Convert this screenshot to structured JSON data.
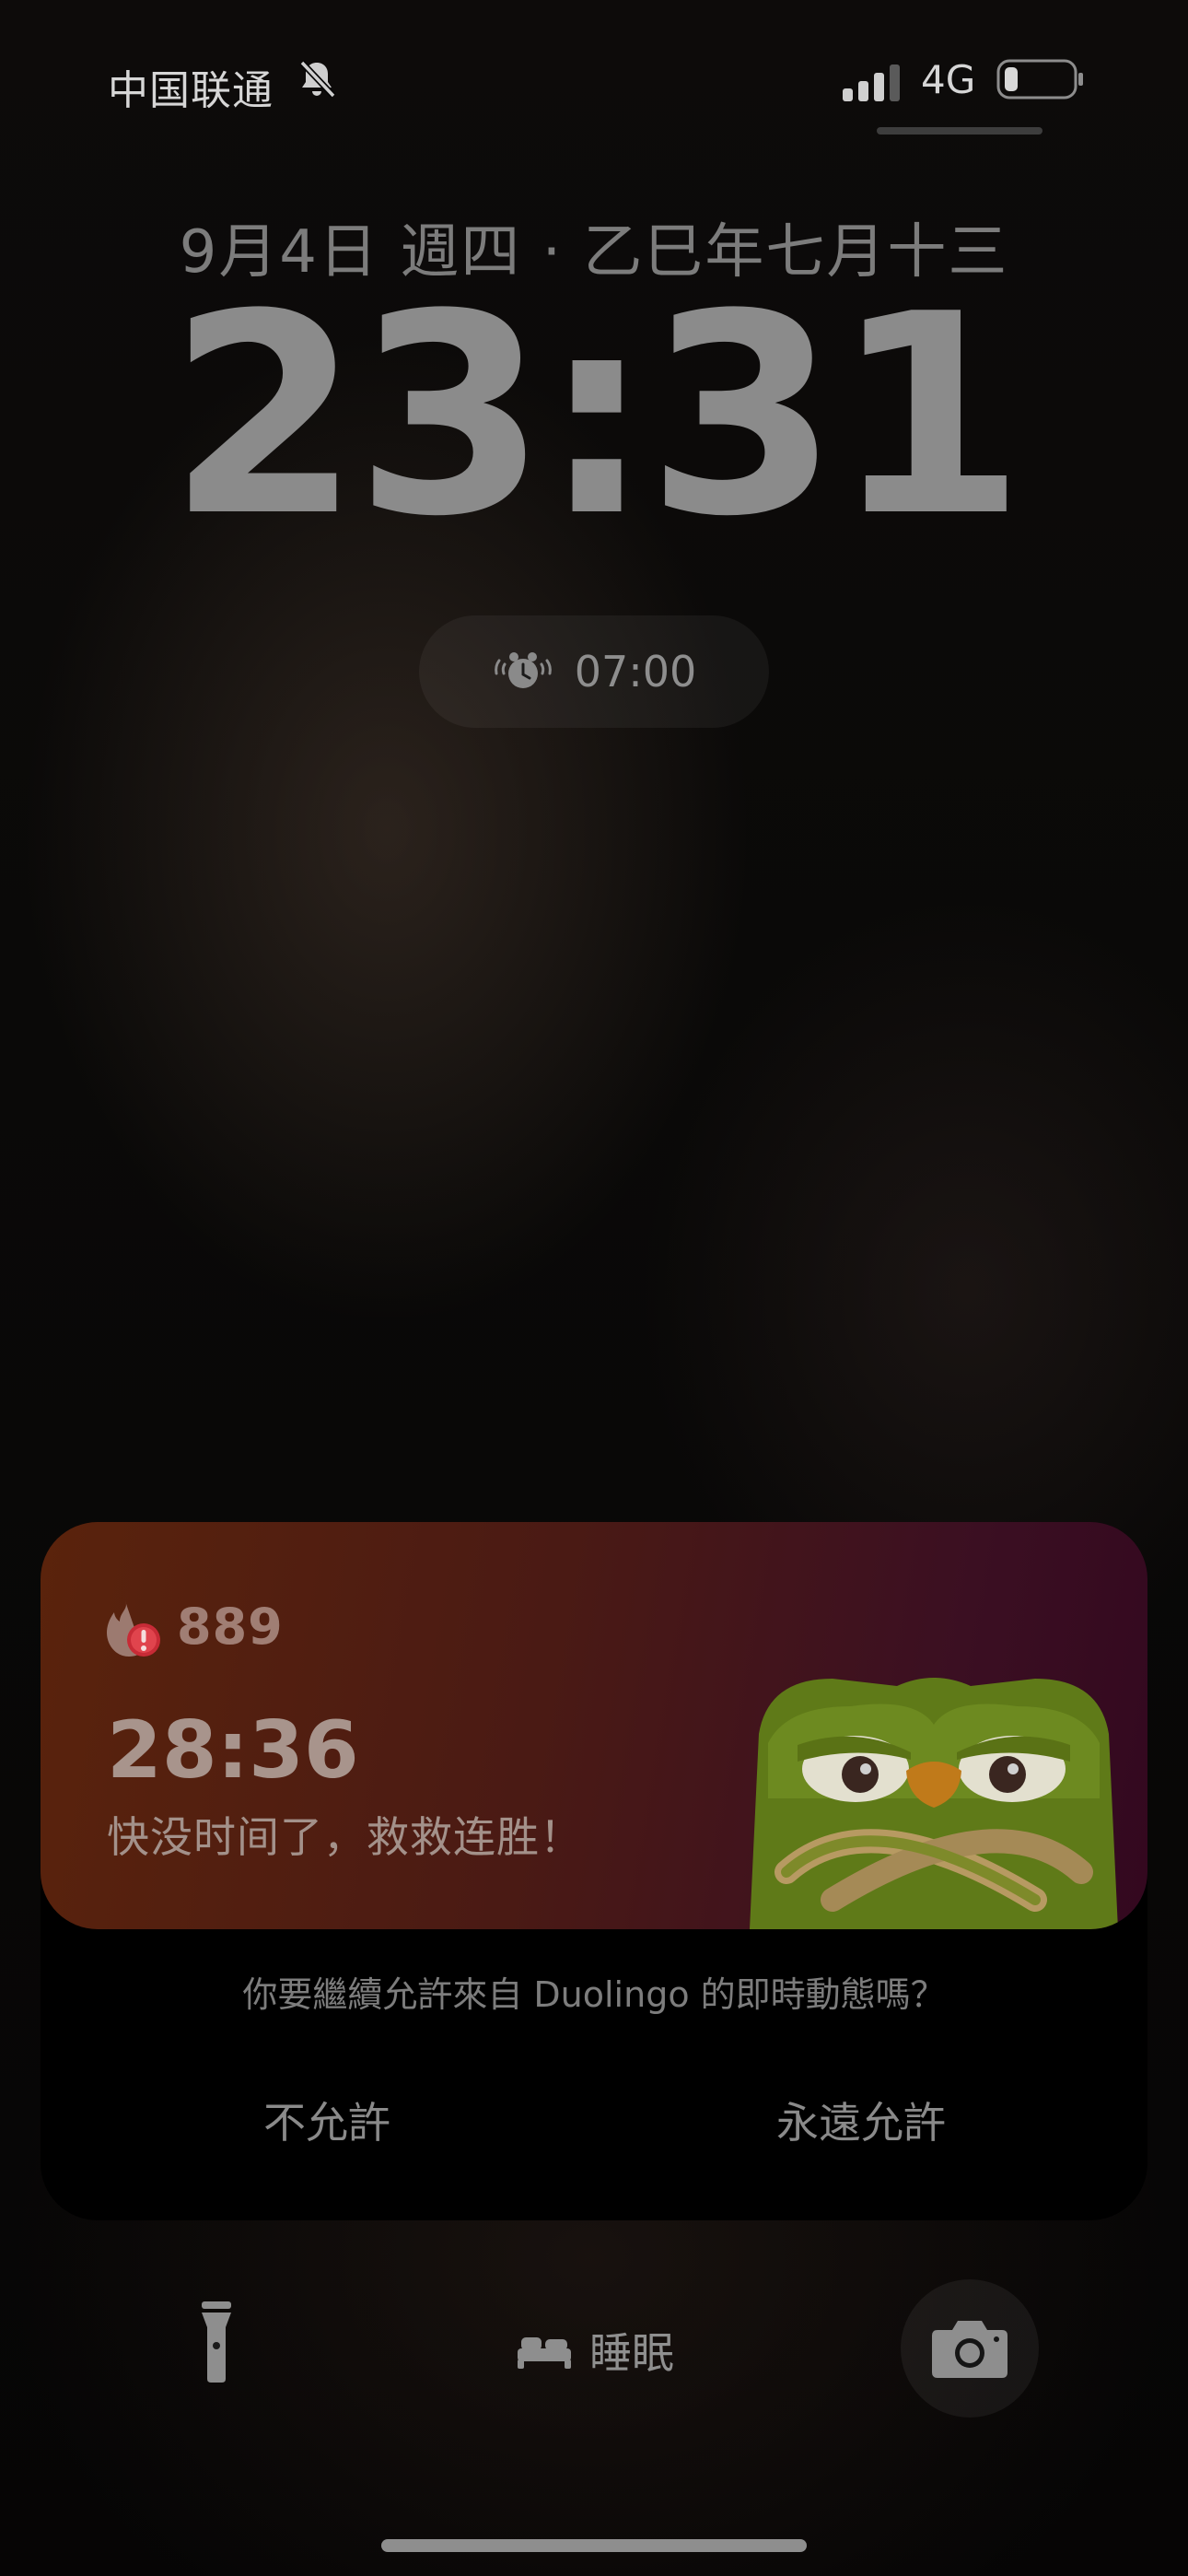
{
  "status_bar": {
    "carrier": "中国联通",
    "network_type": "4G",
    "icons": [
      "mute-bell-icon",
      "signal-icon",
      "battery-icon"
    ]
  },
  "lock_screen": {
    "date": "9月4日 週四 · 乙巳年七月十三",
    "time": "23:31",
    "alarm": {
      "icon": "alarm-clock-icon",
      "time": "07:00"
    }
  },
  "live_activity": {
    "app": "Duolingo",
    "streak_icon": "flame-alert-icon",
    "streak_count": "889",
    "countdown": "28:36",
    "message": "快没时间了，救救连胜！",
    "colors": {
      "card_start": "#5a230c",
      "card_end": "#33081f"
    }
  },
  "permission_prompt": {
    "question": "你要繼續允許來自 Duolingo 的即時動態嗎？",
    "deny_label": "不允許",
    "allow_label": "永遠允許"
  },
  "bottom_controls": {
    "flashlight_icon": "flashlight-icon",
    "sleep_label": "睡眠",
    "sleep_icon": "bed-icon",
    "camera_icon": "camera-icon"
  }
}
